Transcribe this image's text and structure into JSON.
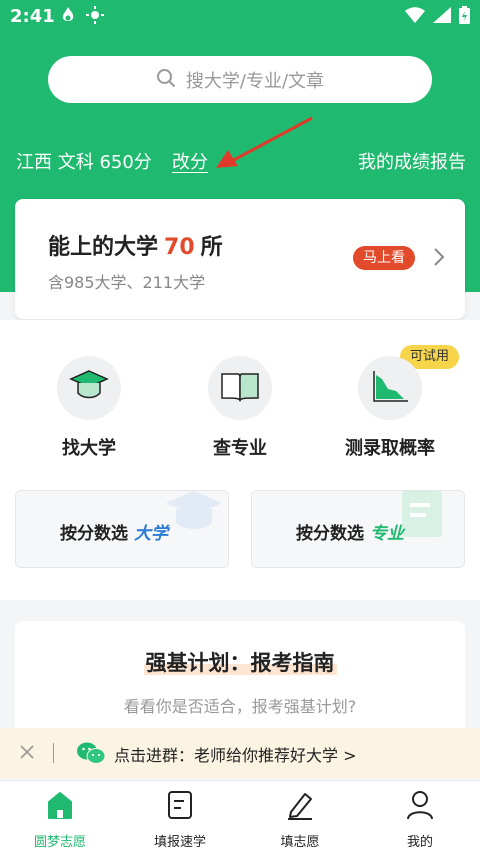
{
  "colors": {
    "primary_green": "#1fba6f",
    "accent_red": "#e14a2a",
    "trial_yellow": "#f7d54a"
  },
  "status_bar": {
    "time": "2:41"
  },
  "search": {
    "placeholder": "搜大学/专业/文章"
  },
  "score": {
    "summary": "江西 文科 650分",
    "change_label": "改分",
    "report_label": "我的成绩报告"
  },
  "uni_card": {
    "title_prefix": "能上的大学",
    "count": "70",
    "title_suffix": "所",
    "subtitle": "含985大学、211大学",
    "badge": "马上看"
  },
  "features": [
    {
      "label": "找大学",
      "icon": "graduation-cap-icon"
    },
    {
      "label": "查专业",
      "icon": "book-icon"
    },
    {
      "label": "测录取概率",
      "icon": "chart-icon"
    }
  ],
  "trial_badge": "可试用",
  "pick_cards": [
    {
      "label": "按分数选",
      "accent": "大学"
    },
    {
      "label": "按分数选",
      "accent": "专业"
    }
  ],
  "strong_plan": {
    "title": "强基计划：报考指南",
    "subtitle": "看看你是否适合，报考强基计划?"
  },
  "notice": {
    "text": "点击进群：老师给你推荐好大学 >"
  },
  "tabs": [
    {
      "label": "圆梦志愿",
      "active": true
    },
    {
      "label": "填报速学",
      "active": false
    },
    {
      "label": "填志愿",
      "active": false
    },
    {
      "label": "我的",
      "active": false
    }
  ]
}
